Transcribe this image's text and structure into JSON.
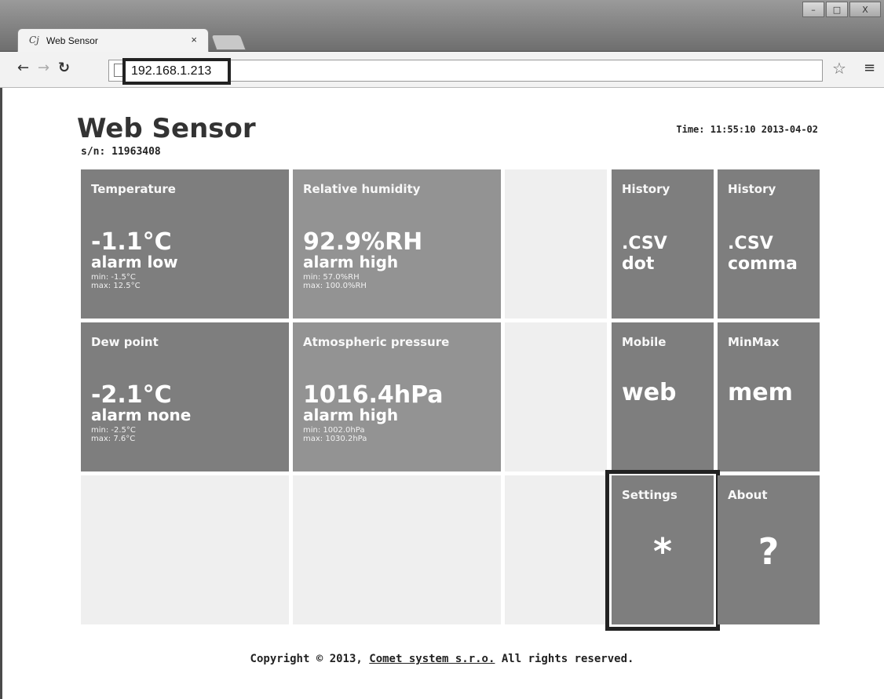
{
  "browser": {
    "tab_icon": "Cj",
    "tab_title": "Web Sensor",
    "tab_close": "×",
    "url": "192.168.1.213",
    "window_buttons": [
      "–",
      "□",
      "X"
    ]
  },
  "header": {
    "title": "Web Sensor",
    "serial": "s/n: 11963408",
    "time": "Time: 11:55:10 2013-04-02"
  },
  "tiles": {
    "temperature": {
      "label": "Temperature",
      "value": "-1.1°C",
      "alarm": "alarm low",
      "min": "min: -1.5°C",
      "max": "max: 12.5°C"
    },
    "humidity": {
      "label": "Relative humidity",
      "value": "92.9%RH",
      "alarm": "alarm high",
      "min": "min: 57.0%RH",
      "max": "max: 100.0%RH"
    },
    "dewpoint": {
      "label": "Dew point",
      "value": "-2.1°C",
      "alarm": "alarm none",
      "min": "min: -2.5°C",
      "max": "max: 7.6°C"
    },
    "pressure": {
      "label": "Atmospheric pressure",
      "value": "1016.4hPa",
      "alarm": "alarm high",
      "min": "min: 1002.0hPa",
      "max": "max: 1030.2hPa"
    },
    "history_dot": {
      "label": "History",
      "line1": ".CSV",
      "line2": "dot"
    },
    "history_comma": {
      "label": "History",
      "line1": ".CSV",
      "line2": "comma"
    },
    "mobile": {
      "label": "Mobile",
      "text": "web"
    },
    "minmax": {
      "label": "MinMax",
      "text": "mem"
    },
    "settings": {
      "label": "Settings",
      "glyph": "*"
    },
    "about": {
      "label": "About",
      "glyph": "?"
    }
  },
  "footer": {
    "prefix": "Copyright © 2013, ",
    "link": "Comet system s.r.o.",
    "suffix": " All rights reserved."
  },
  "colors": {
    "tile_dark": "#7e7e7e",
    "tile_mid": "#939393",
    "tile_empty": "#efefef"
  }
}
